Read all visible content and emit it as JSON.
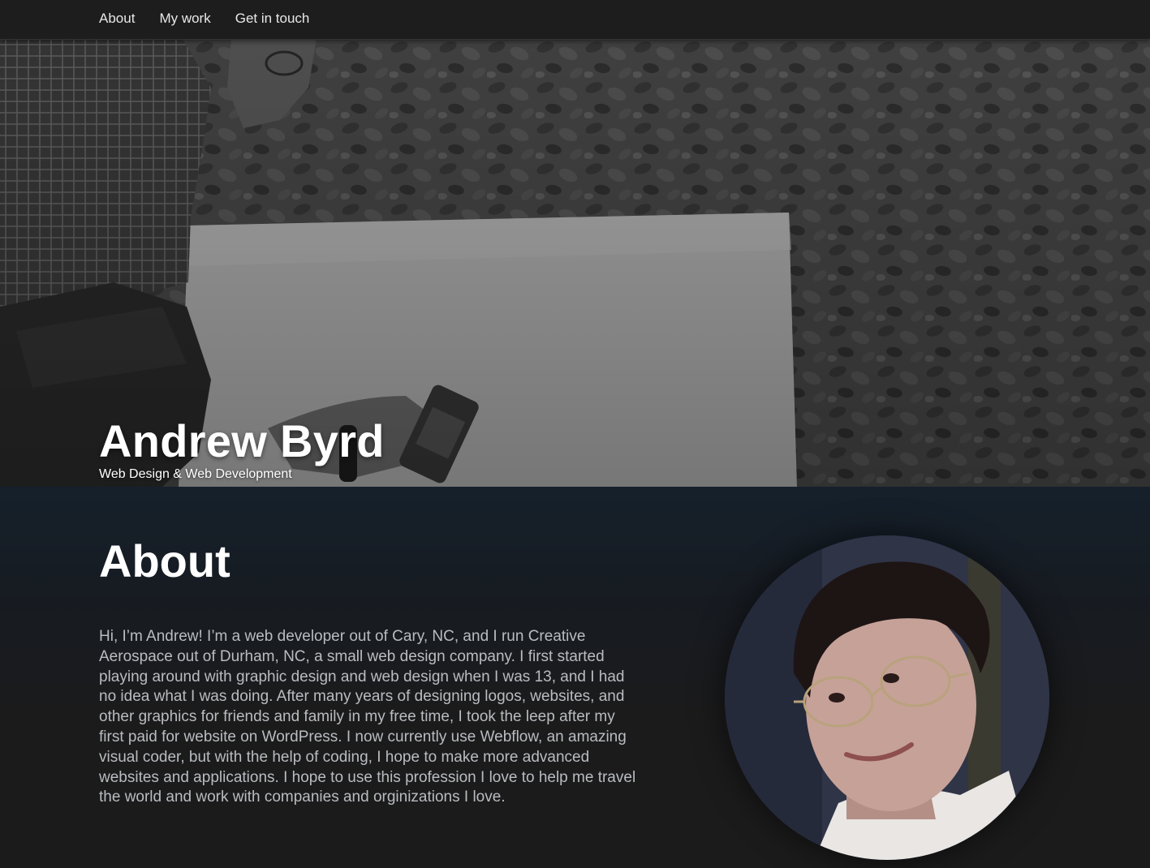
{
  "nav": {
    "items": [
      {
        "label": "About"
      },
      {
        "label": "My work"
      },
      {
        "label": "Get in touch"
      }
    ]
  },
  "hero": {
    "title": "Andrew Byrd",
    "subtitle": "Web Design & Web Development",
    "photo_icon": "hero-photo-grayscale"
  },
  "about": {
    "heading": "About",
    "body": "Hi, I’m Andrew! I’m a web developer out of Cary, NC, and I run Creative Aerospace out of Durham, NC, a small web design company. I first started playing around with graphic design and web design when I was 13, and I had no idea what I was doing. After many years of designing logos, websites, and other graphics for friends and family in my free time, I took the leep after my first paid for website on WordPress. I now currently use Webflow, an amazing visual coder, but with the help of coding, I hope to make more advanced websites and applications. I hope to use this profession I love to help me travel the world and work with companies and orginizations I love.",
    "portrait_icon": "portrait-photo"
  },
  "colors": {
    "nav_bg": "#1d1d1e",
    "page_bg": "#1b1b1c",
    "about_top": "#15202b",
    "body_text": "#b9bcc0",
    "heading_text": "#ffffff"
  }
}
